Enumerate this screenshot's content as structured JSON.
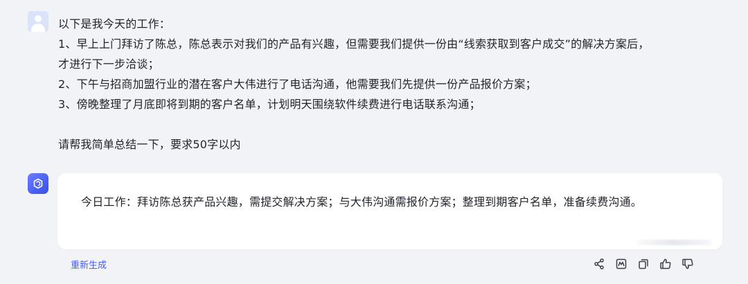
{
  "user": {
    "lines": [
      "以下是我今天的工作：",
      "1、早上上门拜访了陈总，陈总表示对我们的产品有兴趣，但需要我们提供一份由“线索获取到客户成交”的解决方案后，",
      "才进行下一步洽谈；",
      "2、下午与招商加盟行业的潜在客户大伟进行了电话沟通，他需要我们先提供一份产品报价方案；",
      "3、傍晚整理了月底即将到期的客户名单，计划明天围绕软件续费进行电话联系沟通；",
      "请帮我简单总结一下，要求50字以内"
    ]
  },
  "answer": {
    "text": "今日工作：拜访陈总获产品兴趣，需提交解决方案；与大伟沟通需报价方案；整理到期客户名单，准备续费沟通。"
  },
  "actions": {
    "regenerate_label": "重新生成",
    "icons": [
      "share-icon",
      "chart-icon",
      "copy-icon",
      "thumbs-up-icon",
      "thumbs-down-icon"
    ]
  },
  "colors": {
    "background": "#f2f3f7",
    "card": "#ffffff",
    "text": "#1f2329",
    "accent": "#4a5eea",
    "icon": "#3a3f4b",
    "avatar_user": "#dbe3f8"
  }
}
